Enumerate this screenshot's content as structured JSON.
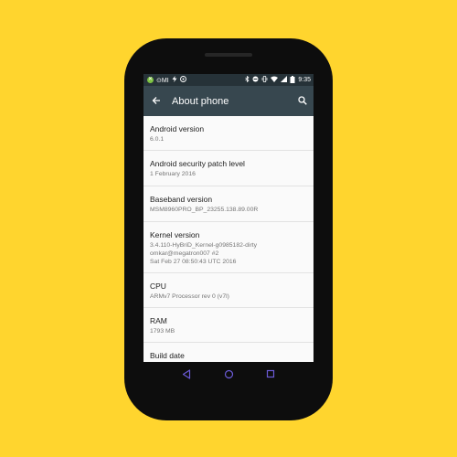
{
  "status_bar": {
    "time": "9:35",
    "left_icons": [
      "xbox-icon",
      "omi-icon",
      "bolt-icon",
      "whatsapp-icon"
    ],
    "omi_label": "⊙MI",
    "right_icons": [
      "bluetooth-icon",
      "do-not-disturb-icon",
      "vibrate-icon",
      "wifi-icon",
      "signal-icon",
      "battery-icon"
    ]
  },
  "toolbar": {
    "title": "About phone",
    "back_icon": "arrow-back-icon",
    "search_icon": "search-icon"
  },
  "settings": [
    {
      "title": "Android version",
      "subtitle": "6.0.1"
    },
    {
      "title": "Android security patch level",
      "subtitle": "1 February 2016"
    },
    {
      "title": "Baseband version",
      "subtitle": "MSM8960PRO_BP_23255.138.89.00R"
    },
    {
      "title": "Kernel version",
      "subtitle_lines": [
        "3.4.110-HyBriD_Kernel-g0985182-dirty",
        "omkar@megatron007 #2",
        "Sat Feb 27 08:50:43 UTC 2016"
      ]
    },
    {
      "title": "CPU",
      "subtitle": "ARMv7 Processor rev 0 (v7l)"
    },
    {
      "title": "RAM",
      "subtitle": "1793 MB"
    },
    {
      "title": "Build date",
      "subtitle": ""
    }
  ],
  "nav_bar": {
    "buttons": [
      "back-triangle-icon",
      "home-circle-icon",
      "recents-square-icon"
    ]
  },
  "colors": {
    "background": "#FFD52E",
    "toolbar": "#37474f",
    "status_bar": "#263238",
    "nav_icons": "#6b5bd6"
  }
}
